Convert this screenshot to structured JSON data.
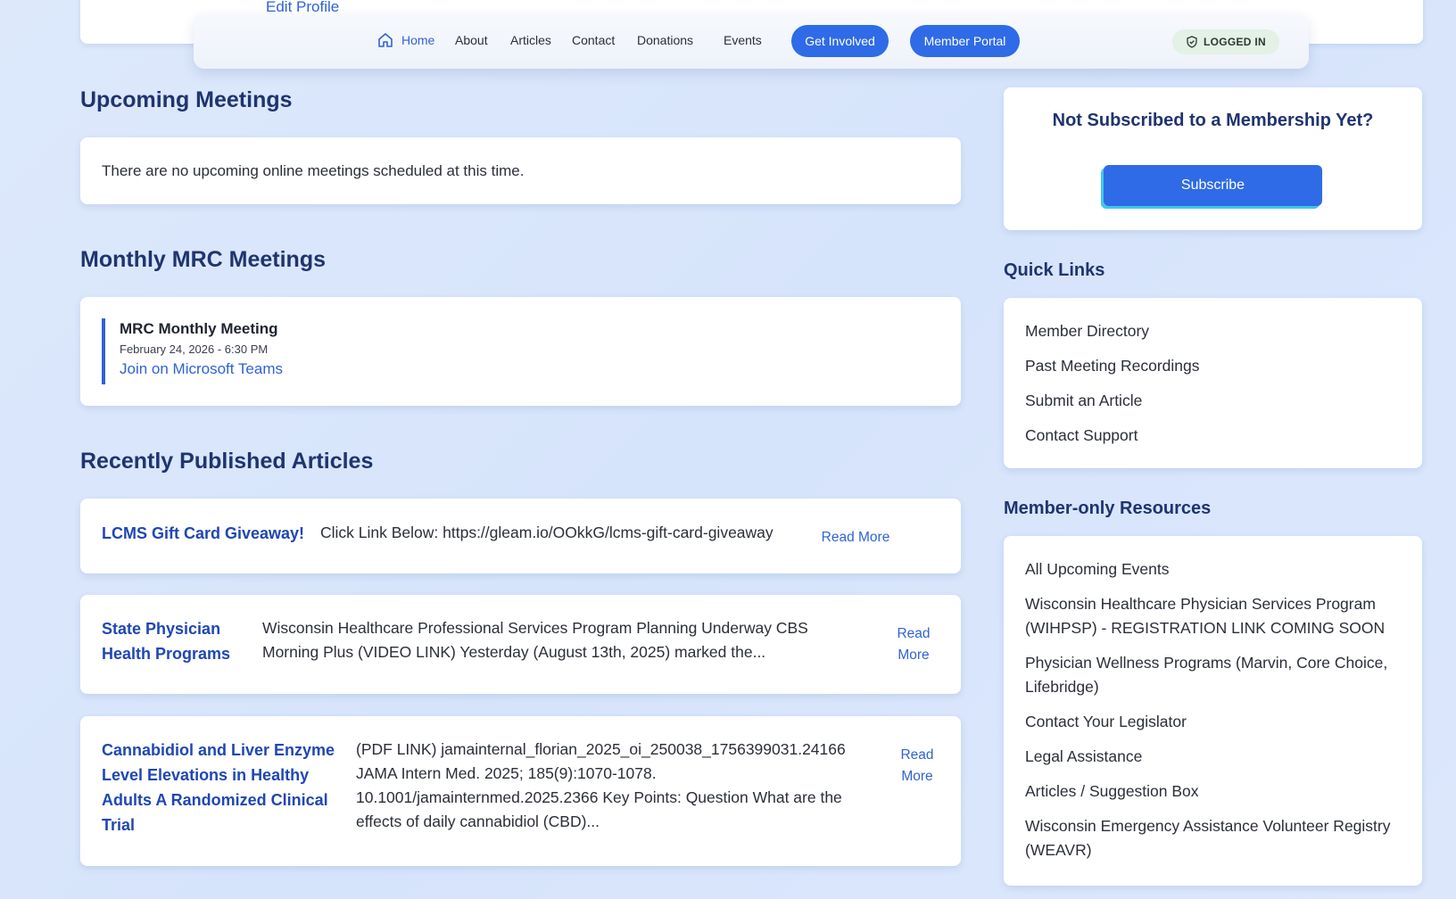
{
  "top": {
    "edit_profile": "Edit Profile"
  },
  "nav": {
    "home": "Home",
    "about": "About",
    "articles": "Articles",
    "contact": "Contact",
    "donations": "Donations",
    "events": "Events",
    "get_involved": "Get Involved",
    "member_portal": "Member Portal",
    "status": "LOGGED IN",
    "colors": {
      "accent": "#2f6be6",
      "status_bg": "#e3f1e6"
    }
  },
  "upcoming": {
    "heading": "Upcoming Meetings",
    "empty_text": "There are no upcoming online meetings scheduled at this time."
  },
  "monthly": {
    "heading": "Monthly MRC Meetings",
    "meeting": {
      "title": "MRC Monthly Meeting",
      "date": "February 24, 2026 - 6:30 PM",
      "link": "Join on Microsoft Teams"
    }
  },
  "articles": {
    "heading": "Recently Published Articles",
    "items": [
      {
        "title": "LCMS Gift Card Giveaway!",
        "desc": "Click Link Below: https://gleam.io/OOkkG/lcms-gift-card-giveaway",
        "more": "Read More"
      },
      {
        "title": "State Physician Health Programs",
        "desc": "Wisconsin Healthcare Professional Services Program Planning Underway   CBS Morning Plus (VIDEO LINK)   Yesterday (August 13th, 2025) marked the...",
        "more": "Read More"
      },
      {
        "title": "Cannabidiol and Liver Enzyme Level Elevations in Healthy Adults A Randomized Clinical Trial",
        "desc": "(PDF LINK) jamainternal_florian_2025_oi_250038_1756399031.24166 JAMA Intern Med. 2025; 185(9):1070-1078. 10.1001/jamainternmed.2025.2366 Key Points: Question  What are the effects of daily cannabidiol (CBD)...",
        "more": "Read More"
      }
    ]
  },
  "subscribe": {
    "title": "Not Subscribed to a Membership Yet?",
    "button": "Subscribe"
  },
  "quick_links": {
    "heading": "Quick Links",
    "items": [
      "Member Directory",
      "Past Meeting Recordings",
      "Submit an Article",
      "Contact Support"
    ]
  },
  "member_resources": {
    "heading": "Member-only Resources",
    "items": [
      "All Upcoming Events",
      "Wisconsin Healthcare Physician Services Program (WIHPSP) - REGISTRATION LINK COMING SOON",
      "Physician Wellness Programs (Marvin, Core Choice, Lifebridge)",
      "Contact Your Legislator",
      "Legal Assistance",
      "Articles / Suggestion Box",
      "Wisconsin Emergency Assistance Volunteer Registry (WEAVR)"
    ]
  }
}
